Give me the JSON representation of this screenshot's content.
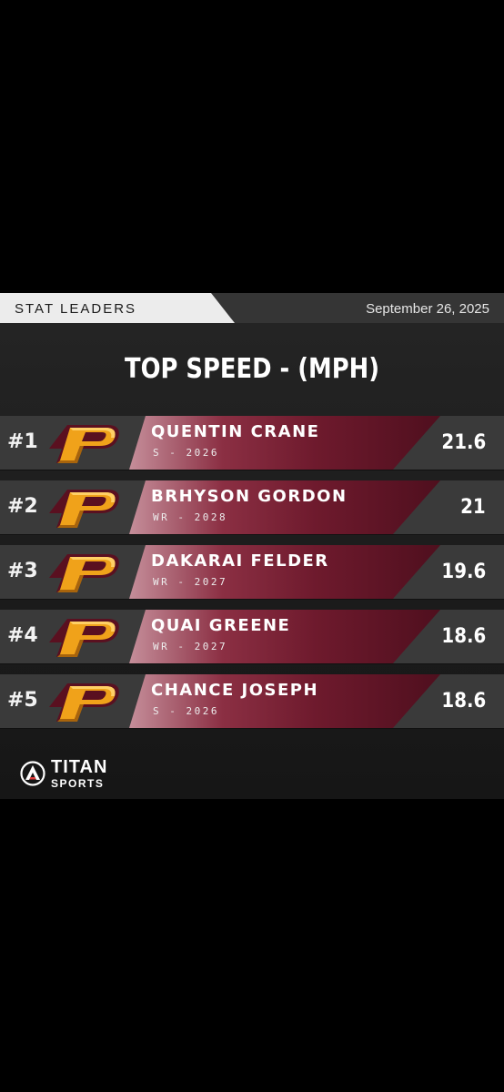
{
  "header": {
    "section_label": "STAT LEADERS",
    "date": "September 26, 2025"
  },
  "title": "TOP SPEED - (MPH)",
  "leaders": [
    {
      "rank": "#1",
      "name": "QUENTIN CRANE",
      "info": "S - 2026",
      "value": "21.6"
    },
    {
      "rank": "#2",
      "name": "BRHYSON GORDON",
      "info": "WR - 2028",
      "value": "21"
    },
    {
      "rank": "#3",
      "name": "DAKARAI FELDER",
      "info": "WR - 2027",
      "value": "19.6"
    },
    {
      "rank": "#4",
      "name": "QUAI GREENE",
      "info": "WR - 2027",
      "value": "18.6"
    },
    {
      "rank": "#5",
      "name": "CHANCE JOSEPH",
      "info": "S - 2026",
      "value": "18.6"
    }
  ],
  "logo": {
    "letter": "P",
    "icon": "team-p-logo-icon",
    "colors": {
      "gold": "#f0a21a",
      "dark_gold": "#a8640c",
      "maroon": "#5a1020"
    }
  },
  "brand": {
    "name": "TITAN",
    "sub": "SPORTS",
    "icon": "titan-a-logo-icon",
    "colors": {
      "accent": "#e03a3a",
      "white": "#ffffff"
    }
  },
  "colors": {
    "background": "#000000",
    "card": "#1e1e1e",
    "row": "#3a3a3a",
    "band_light": "#c58e9a",
    "band_dark": "#4f0f1e"
  }
}
